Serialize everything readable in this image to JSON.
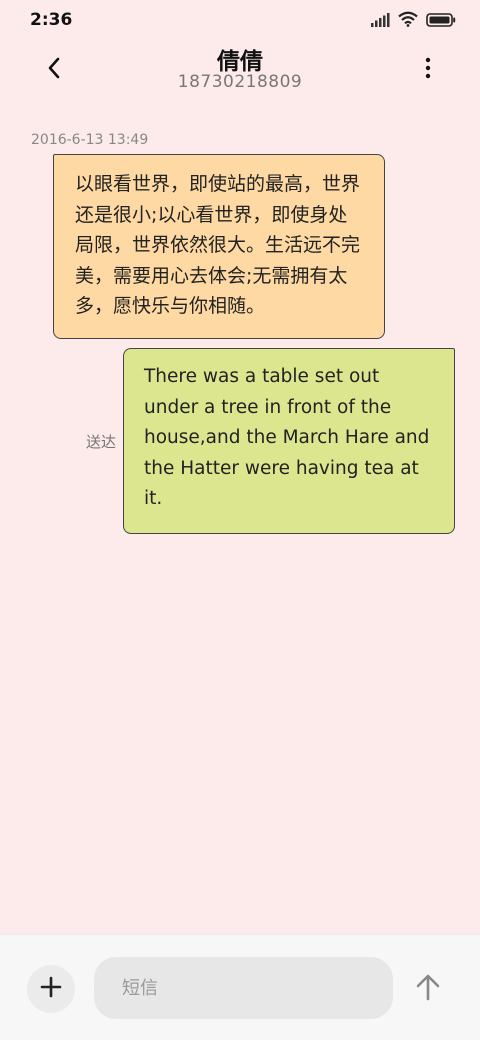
{
  "status_bar": {
    "time": "2:36",
    "icons": [
      "signal-icon",
      "wifi-icon",
      "battery-icon"
    ]
  },
  "header": {
    "contact_name": "倩倩",
    "contact_number": "18730218809",
    "back_icon": "chevron-left-icon",
    "more_icon": "more-vertical-icon"
  },
  "conversation": {
    "timestamp": "2016-6-13 13:49",
    "messages": [
      {
        "direction": "received",
        "lines": [
          "以眼看世界，即使站的最高，世界",
          "还是很小;以心看世界，即使身处",
          "局限，世界依然很大。生活远不完",
          "美，需要用心去体会;无需拥有太",
          "多，愿快乐与你相随。"
        ],
        "color": "#ffd9a3"
      },
      {
        "direction": "sent",
        "lines": [
          "There was a table set out",
          "under a tree in front of the",
          "house,and the March Hare and",
          "the Hatter were having tea at",
          "it."
        ],
        "status": "送达",
        "color": "#dce68f"
      }
    ]
  },
  "composer": {
    "placeholder": "短信",
    "add_icon": "plus-icon",
    "send_icon": "arrow-up-icon"
  },
  "colors": {
    "background": "#fdeaea",
    "bottom_bar": "#f7f7f7"
  }
}
